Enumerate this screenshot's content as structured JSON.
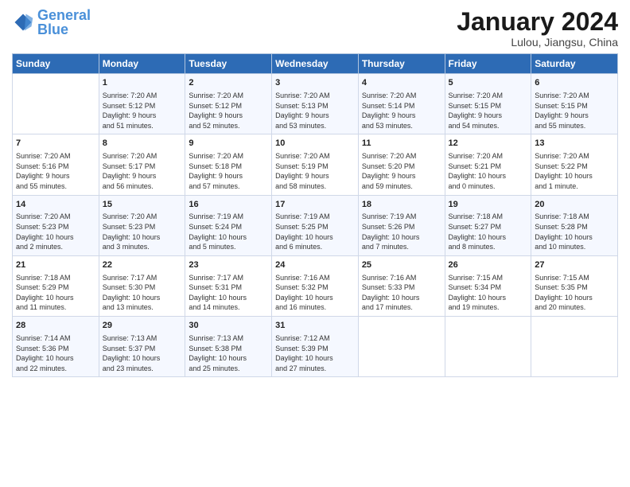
{
  "header": {
    "logo_line1": "General",
    "logo_line2": "Blue",
    "main_title": "January 2024",
    "subtitle": "Lulou, Jiangsu, China"
  },
  "days_of_week": [
    "Sunday",
    "Monday",
    "Tuesday",
    "Wednesday",
    "Thursday",
    "Friday",
    "Saturday"
  ],
  "weeks": [
    [
      {
        "day": "",
        "info": ""
      },
      {
        "day": "1",
        "info": "Sunrise: 7:20 AM\nSunset: 5:12 PM\nDaylight: 9 hours\nand 51 minutes."
      },
      {
        "day": "2",
        "info": "Sunrise: 7:20 AM\nSunset: 5:12 PM\nDaylight: 9 hours\nand 52 minutes."
      },
      {
        "day": "3",
        "info": "Sunrise: 7:20 AM\nSunset: 5:13 PM\nDaylight: 9 hours\nand 53 minutes."
      },
      {
        "day": "4",
        "info": "Sunrise: 7:20 AM\nSunset: 5:14 PM\nDaylight: 9 hours\nand 53 minutes."
      },
      {
        "day": "5",
        "info": "Sunrise: 7:20 AM\nSunset: 5:15 PM\nDaylight: 9 hours\nand 54 minutes."
      },
      {
        "day": "6",
        "info": "Sunrise: 7:20 AM\nSunset: 5:15 PM\nDaylight: 9 hours\nand 55 minutes."
      }
    ],
    [
      {
        "day": "7",
        "info": "Sunrise: 7:20 AM\nSunset: 5:16 PM\nDaylight: 9 hours\nand 55 minutes."
      },
      {
        "day": "8",
        "info": "Sunrise: 7:20 AM\nSunset: 5:17 PM\nDaylight: 9 hours\nand 56 minutes."
      },
      {
        "day": "9",
        "info": "Sunrise: 7:20 AM\nSunset: 5:18 PM\nDaylight: 9 hours\nand 57 minutes."
      },
      {
        "day": "10",
        "info": "Sunrise: 7:20 AM\nSunset: 5:19 PM\nDaylight: 9 hours\nand 58 minutes."
      },
      {
        "day": "11",
        "info": "Sunrise: 7:20 AM\nSunset: 5:20 PM\nDaylight: 9 hours\nand 59 minutes."
      },
      {
        "day": "12",
        "info": "Sunrise: 7:20 AM\nSunset: 5:21 PM\nDaylight: 10 hours\nand 0 minutes."
      },
      {
        "day": "13",
        "info": "Sunrise: 7:20 AM\nSunset: 5:22 PM\nDaylight: 10 hours\nand 1 minute."
      }
    ],
    [
      {
        "day": "14",
        "info": "Sunrise: 7:20 AM\nSunset: 5:23 PM\nDaylight: 10 hours\nand 2 minutes."
      },
      {
        "day": "15",
        "info": "Sunrise: 7:20 AM\nSunset: 5:23 PM\nDaylight: 10 hours\nand 3 minutes."
      },
      {
        "day": "16",
        "info": "Sunrise: 7:19 AM\nSunset: 5:24 PM\nDaylight: 10 hours\nand 5 minutes."
      },
      {
        "day": "17",
        "info": "Sunrise: 7:19 AM\nSunset: 5:25 PM\nDaylight: 10 hours\nand 6 minutes."
      },
      {
        "day": "18",
        "info": "Sunrise: 7:19 AM\nSunset: 5:26 PM\nDaylight: 10 hours\nand 7 minutes."
      },
      {
        "day": "19",
        "info": "Sunrise: 7:18 AM\nSunset: 5:27 PM\nDaylight: 10 hours\nand 8 minutes."
      },
      {
        "day": "20",
        "info": "Sunrise: 7:18 AM\nSunset: 5:28 PM\nDaylight: 10 hours\nand 10 minutes."
      }
    ],
    [
      {
        "day": "21",
        "info": "Sunrise: 7:18 AM\nSunset: 5:29 PM\nDaylight: 10 hours\nand 11 minutes."
      },
      {
        "day": "22",
        "info": "Sunrise: 7:17 AM\nSunset: 5:30 PM\nDaylight: 10 hours\nand 13 minutes."
      },
      {
        "day": "23",
        "info": "Sunrise: 7:17 AM\nSunset: 5:31 PM\nDaylight: 10 hours\nand 14 minutes."
      },
      {
        "day": "24",
        "info": "Sunrise: 7:16 AM\nSunset: 5:32 PM\nDaylight: 10 hours\nand 16 minutes."
      },
      {
        "day": "25",
        "info": "Sunrise: 7:16 AM\nSunset: 5:33 PM\nDaylight: 10 hours\nand 17 minutes."
      },
      {
        "day": "26",
        "info": "Sunrise: 7:15 AM\nSunset: 5:34 PM\nDaylight: 10 hours\nand 19 minutes."
      },
      {
        "day": "27",
        "info": "Sunrise: 7:15 AM\nSunset: 5:35 PM\nDaylight: 10 hours\nand 20 minutes."
      }
    ],
    [
      {
        "day": "28",
        "info": "Sunrise: 7:14 AM\nSunset: 5:36 PM\nDaylight: 10 hours\nand 22 minutes."
      },
      {
        "day": "29",
        "info": "Sunrise: 7:13 AM\nSunset: 5:37 PM\nDaylight: 10 hours\nand 23 minutes."
      },
      {
        "day": "30",
        "info": "Sunrise: 7:13 AM\nSunset: 5:38 PM\nDaylight: 10 hours\nand 25 minutes."
      },
      {
        "day": "31",
        "info": "Sunrise: 7:12 AM\nSunset: 5:39 PM\nDaylight: 10 hours\nand 27 minutes."
      },
      {
        "day": "",
        "info": ""
      },
      {
        "day": "",
        "info": ""
      },
      {
        "day": "",
        "info": ""
      }
    ]
  ]
}
